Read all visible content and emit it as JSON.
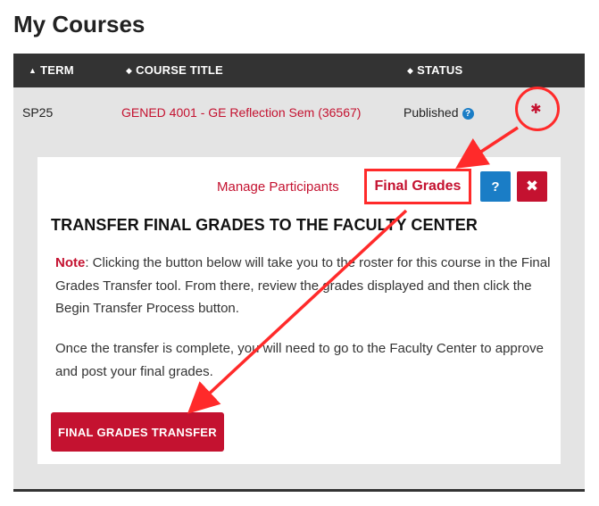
{
  "page": {
    "title": "My Courses"
  },
  "table": {
    "headers": [
      {
        "label": "TERM",
        "icon": "sort-up-icon"
      },
      {
        "label": "COURSE TITLE",
        "icon": "sort-both-icon"
      },
      {
        "label": "STATUS",
        "icon": "sort-both-icon"
      }
    ],
    "row": {
      "term": "SP25",
      "course_title": "GENED 4001 - GE Reflection Sem (36567)",
      "status": "Published",
      "help_glyph": "?",
      "gear_glyph": "✱"
    }
  },
  "panel": {
    "manage_participants": "Manage Participants",
    "final_grades": "Final Grades",
    "help_glyph": "?",
    "close_glyph": "✖",
    "heading": "TRANSFER FINAL GRADES TO THE FACULTY CENTER",
    "note_label": "Note",
    "note_text": ": Clicking the button below will take you to the roster for this course in the Final Grades Transfer tool. From there, review the grades displayed and then click the Begin Transfer Process button.",
    "paragraph2": "Once the transfer is complete, you will need to go to the Faculty Center to approve and post your final grades.",
    "transfer_button": "FINAL GRADES TRANSFER"
  },
  "colors": {
    "accent_red": "#c41230",
    "annotation_red": "#ff2a2a",
    "info_blue": "#1a7dc6",
    "header_dark": "#333333"
  }
}
